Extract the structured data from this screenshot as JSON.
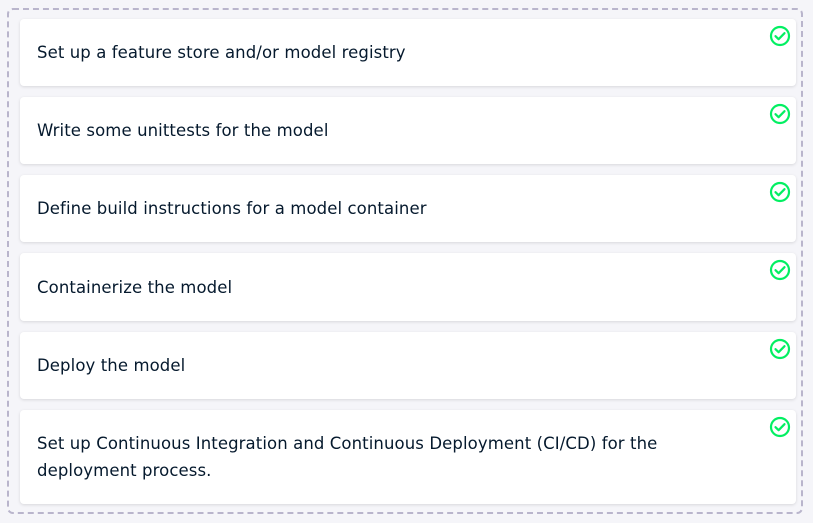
{
  "colors": {
    "check": "#03ef62",
    "text": "#05192d",
    "card": "#ffffff",
    "border": "#b9b5cc"
  },
  "items": [
    {
      "label": "Set up a feature store and/or model registry",
      "status_icon": "check-circle-icon"
    },
    {
      "label": "Write some unittests for the model",
      "status_icon": "check-circle-icon"
    },
    {
      "label": "Define build instructions for a model container",
      "status_icon": "check-circle-icon"
    },
    {
      "label": "Containerize the model",
      "status_icon": "check-circle-icon"
    },
    {
      "label": "Deploy the model",
      "status_icon": "check-circle-icon"
    },
    {
      "label": "Set up Continuous Integration and Continuous Deployment (CI/CD) for the deployment process.",
      "status_icon": "check-circle-icon"
    }
  ]
}
